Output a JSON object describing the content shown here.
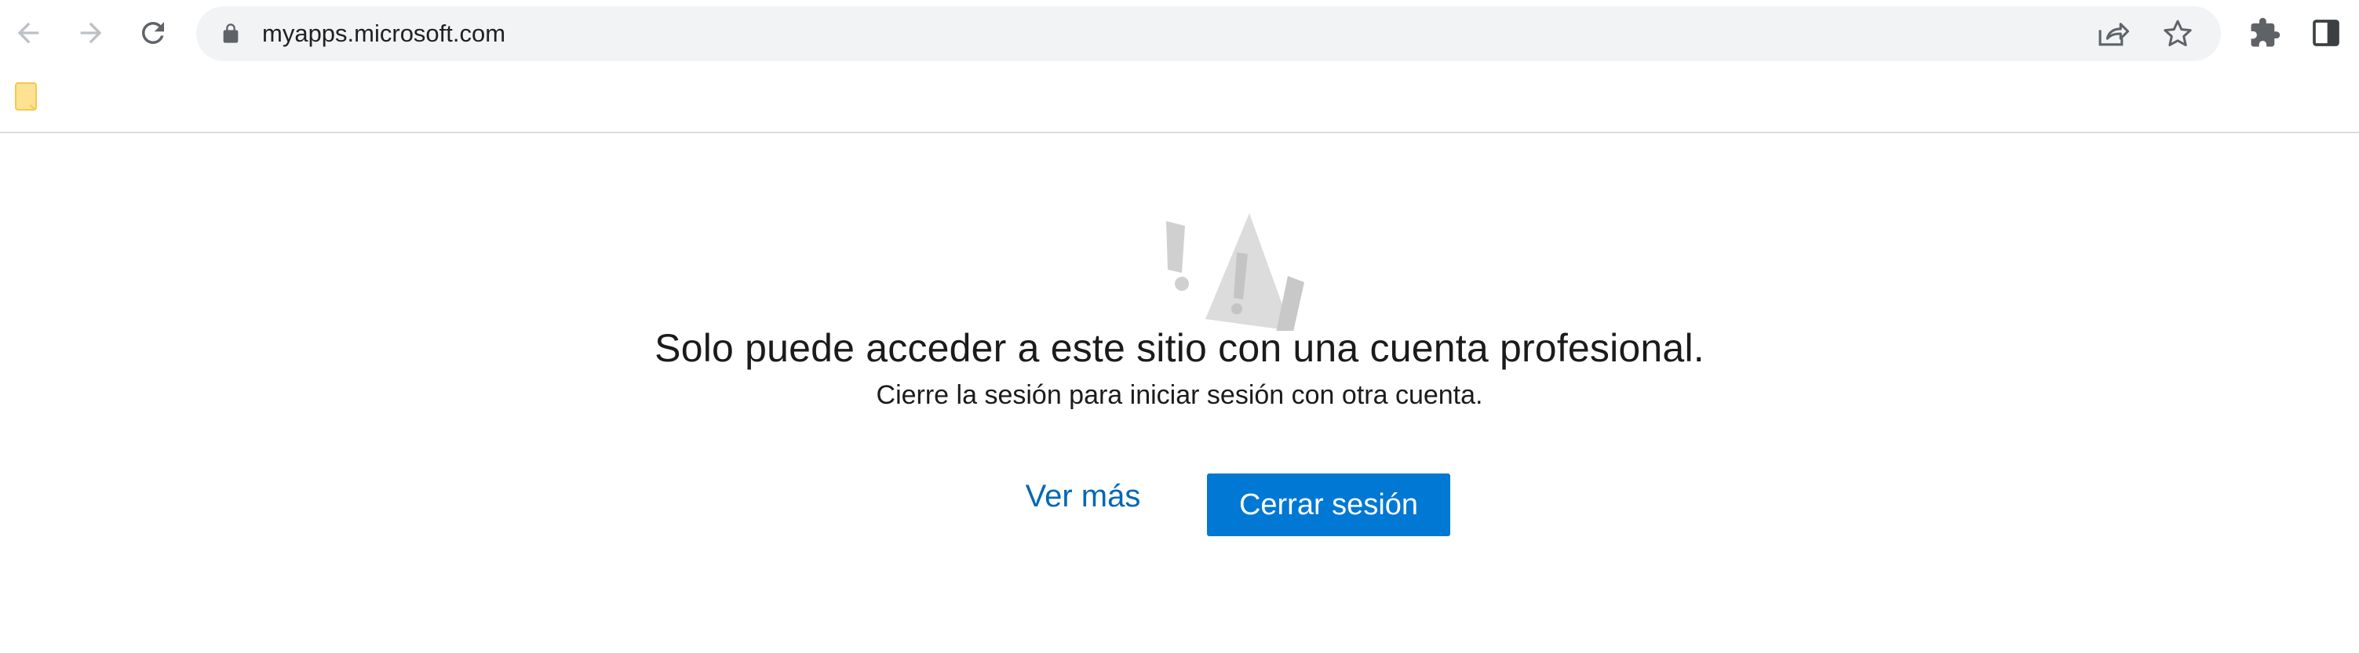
{
  "browser": {
    "url": "myapps.microsoft.com",
    "icons": {
      "back": "arrow-left-icon",
      "forward": "arrow-right-icon",
      "reload": "reload-icon",
      "lock": "lock-icon",
      "share": "share-icon",
      "bookmark": "star-icon",
      "extensions": "puzzle-icon",
      "side_panel": "side-panel-icon",
      "bookmark_folder": "folder-icon"
    }
  },
  "page": {
    "heading": "Solo puede acceder a este sitio con una cuenta profesional.",
    "subtext": "Cierre la sesión para iniciar sesión con otra cuenta.",
    "more_link": "Ver más",
    "signout_button": "Cerrar sesión",
    "illustration": "warning-illustration"
  },
  "colors": {
    "accent": "#0078d4",
    "link": "#0067b8",
    "omnibox_bg": "#f1f3f4"
  }
}
